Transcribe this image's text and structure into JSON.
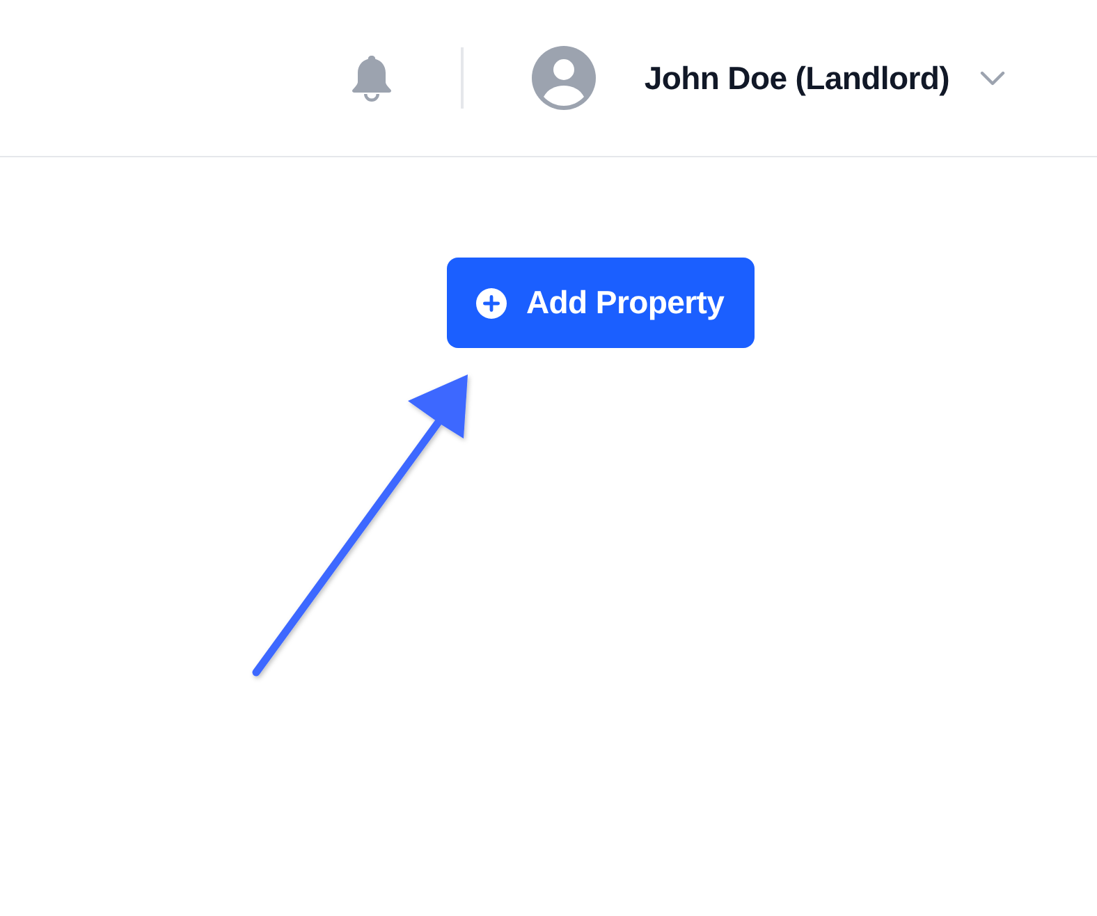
{
  "header": {
    "user_name": "John Doe (Landlord)"
  },
  "add_property_button": {
    "label": "Add Property"
  }
}
